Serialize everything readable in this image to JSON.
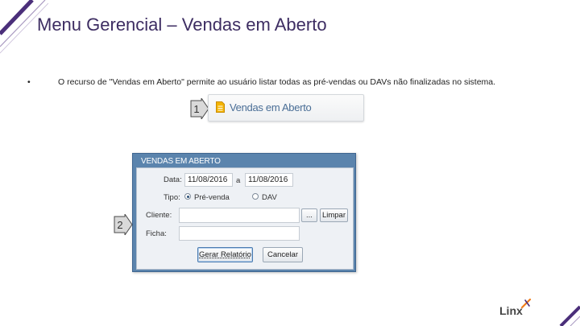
{
  "slide": {
    "title": "Menu Gerencial – Vendas em Aberto",
    "bullet_marker": "•",
    "bullet_text": "O recurso de \"Vendas em Aberto\" permite ao usuário listar todas as pré-vendas ou DAVs não finalizadas no sistema."
  },
  "menu_button": {
    "label": "Vendas em Aberto",
    "icon": "document-icon"
  },
  "steps": {
    "step1": "1",
    "step2": "2"
  },
  "dialog": {
    "title": "VENDAS EM ABERTO",
    "date_label": "Data:",
    "date_from": "11/08/2016",
    "date_separator": "a",
    "date_to": "11/08/2016",
    "type_label": "Tipo:",
    "type_options": [
      "Pré-venda",
      "DAV"
    ],
    "type_selected": "Pré-venda",
    "client_label": "Cliente:",
    "client_value": "",
    "browse_label": "...",
    "clear_label": "Limpar",
    "ficha_label": "Ficha:",
    "ficha_value": "",
    "generate_label": "Gerar Relatório",
    "cancel_label": "Cancelar"
  },
  "logo": {
    "text": "Linx"
  },
  "colors": {
    "title": "#3d2d62",
    "accent_purple": "#4b2f7a",
    "dialog_header": "#5b84ad",
    "logo_accent": "#f07d1a"
  }
}
